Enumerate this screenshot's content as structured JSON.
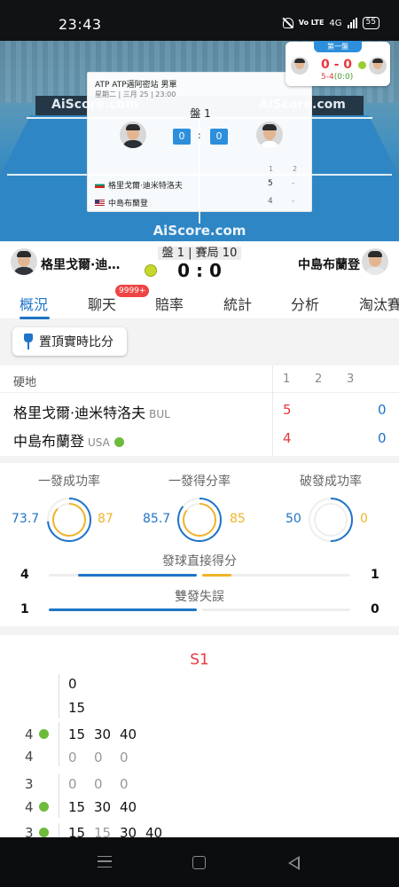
{
  "status_bar": {
    "time": "23:43",
    "network": "4G",
    "battery": "55",
    "volte": "Vo LTE"
  },
  "court": {
    "banner_text": "AiScore.com",
    "watermark": "AiScore.com"
  },
  "popup": {
    "tournament": "ATP ATP邁阿密站 男單",
    "date": "星期二 | 三月 25 | 23:00",
    "set_label": "盤 1",
    "score_left": "0",
    "score_right": "0",
    "colon": ":",
    "col_headers": [
      "1",
      "2"
    ],
    "rows": [
      {
        "name": "格里戈爾·迪米特洛夫",
        "flag": "bulgaria-flag-icon",
        "s1": "5",
        "s2": "-"
      },
      {
        "name": "中島布蘭登",
        "flag": "usa-flag-icon",
        "s1": "4",
        "s2": "-"
      }
    ]
  },
  "mini_score": {
    "set_tag": "第一盤",
    "score": "0 - 0",
    "game_score": "5-4",
    "point_score": "(0:0)"
  },
  "scoreboard": {
    "player1": "格里戈爾·迪…",
    "player2": "中島布蘭登",
    "status": "盤 1 | 賽局 10",
    "score": "0 : 0"
  },
  "tabs": [
    {
      "label": "概況",
      "active": true
    },
    {
      "label": "聊天",
      "badge": "9999+"
    },
    {
      "label": "賠率"
    },
    {
      "label": "統計"
    },
    {
      "label": "分析"
    },
    {
      "label": "淘汰賽"
    }
  ],
  "pin_button": {
    "label": "置頂實時比分"
  },
  "set_table": {
    "surface": "硬地",
    "set_headers": [
      "1",
      "2",
      "3"
    ],
    "players": [
      {
        "name": "格里戈爾·迪米特洛夫",
        "country": "BUL",
        "set1": "5",
        "points": "0",
        "serving": false
      },
      {
        "name": "中島布蘭登",
        "country": "USA",
        "set1": "4",
        "points": "0",
        "serving": true
      }
    ]
  },
  "stats": {
    "rings": [
      {
        "label": "一發成功率",
        "left": "73.7",
        "right": "87",
        "left_pct": 73.7,
        "right_pct": 87
      },
      {
        "label": "一發得分率",
        "left": "85.7",
        "right": "85",
        "left_pct": 85.7,
        "right_pct": 85
      },
      {
        "label": "破發成功率",
        "left": "50",
        "right": "0",
        "left_pct": 50,
        "right_pct": 0
      }
    ],
    "bars": [
      {
        "label": "發球直接得分",
        "left": "4",
        "right": "1",
        "left_value": 4,
        "right_value": 1
      },
      {
        "label": "雙發失誤",
        "left": "1",
        "right": "0",
        "left_value": 1,
        "right_value": 0
      }
    ],
    "colors": {
      "left": "#1e74c7",
      "right": "#f0b429",
      "track": "#eeeeee"
    }
  },
  "set_detail": {
    "title": "S1",
    "games": [
      {
        "server": "",
        "points": [
          "0"
        ]
      },
      {
        "server": "",
        "points": [
          "15"
        ]
      },
      {
        "server": "4",
        "points": [
          "15",
          "30",
          "40"
        ]
      },
      {
        "server": "4",
        "points": [
          "0",
          "0",
          "0"
        ]
      },
      {
        "server": "3",
        "points": [
          "0",
          "0",
          "0"
        ]
      },
      {
        "server": "4",
        "points": [
          "15",
          "30",
          "40"
        ]
      },
      {
        "server": "3",
        "points": [
          "15",
          "15",
          "30",
          "40"
        ]
      }
    ]
  }
}
